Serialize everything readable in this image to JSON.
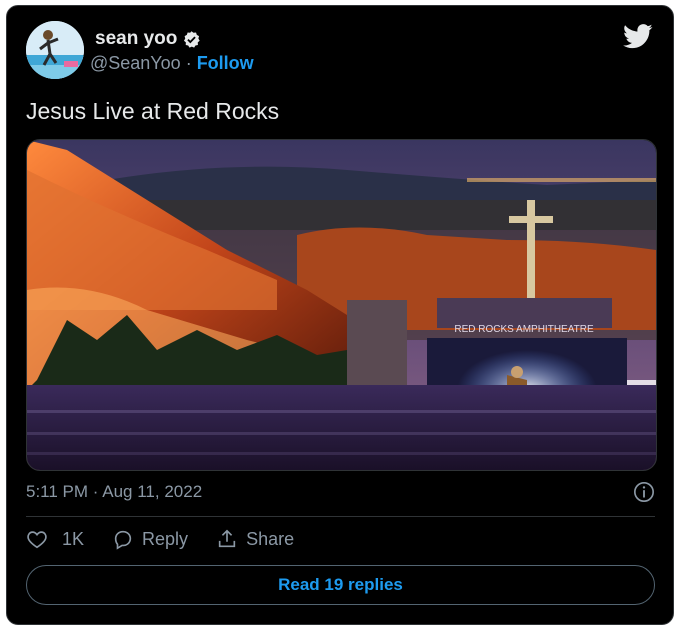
{
  "author": {
    "name": "sean yoo",
    "handle": "@SeanYoo",
    "separator": "·",
    "follow_label": "Follow"
  },
  "icons": {
    "verified": "verified-badge-icon",
    "brand": "twitter-bird-icon",
    "info": "info-icon",
    "like": "heart-icon",
    "reply": "reply-bubble-icon",
    "share": "share-upload-icon"
  },
  "tweet": {
    "text": "Jesus Live at Red Rocks",
    "media_sign": "RED ROCKS AMPHITHEATRE"
  },
  "meta": {
    "time": "5:11 PM",
    "separator": "·",
    "date": "Aug 11, 2022"
  },
  "actions": {
    "like_count": "1K",
    "reply_label": "Reply",
    "share_label": "Share"
  },
  "read_replies": "Read 19 replies",
  "colors": {
    "accent": "#1d9bf0",
    "background": "#000000",
    "text": "#e7e9ea",
    "muted": "#8b98a5",
    "border": "#2f3336"
  }
}
